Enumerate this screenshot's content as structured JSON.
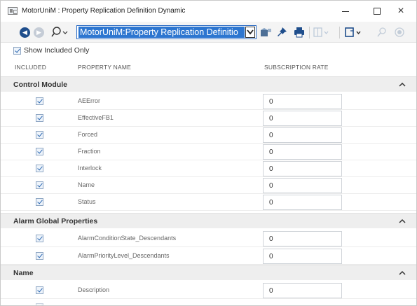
{
  "window": {
    "title": "MotorUniM : Property Replication Definition Dynamic",
    "close_glyph": "×"
  },
  "toolbar": {
    "back_glyph": "◀",
    "forward_glyph": "▶",
    "address_text": "MotorUniM:Property Replication Definitio",
    "icons": [
      "back-icon",
      "forward-icon",
      "search-icon",
      "chevron-down-icon",
      "package-icon",
      "pin-icon",
      "print-icon",
      "columns-icon",
      "document-icon",
      "zoom-icon",
      "target-icon"
    ]
  },
  "filter": {
    "show_included_label": "Show Included Only",
    "checked": true
  },
  "columns": {
    "included": "INCLUDED",
    "property_name": "PROPERTY NAME",
    "subscription_rate": "SUBSCRIPTION RATE"
  },
  "groups": [
    {
      "title": "Control Module",
      "rows": [
        {
          "name": "AEError",
          "rate": "0"
        },
        {
          "name": "EffectiveFB1",
          "rate": "0"
        },
        {
          "name": "Forced",
          "rate": "0"
        },
        {
          "name": "Fraction",
          "rate": "0"
        },
        {
          "name": "Interlock",
          "rate": "0"
        },
        {
          "name": "Name",
          "rate": "0"
        },
        {
          "name": "Status",
          "rate": "0"
        }
      ]
    },
    {
      "title": "Alarm Global Properties",
      "rows": [
        {
          "name": "AlarmConditionState_Descendants",
          "rate": "0"
        },
        {
          "name": "AlarmPriorityLevel_Descendants",
          "rate": "0"
        }
      ]
    },
    {
      "title": "Name",
      "rows": [
        {
          "name": "Description",
          "rate": "0"
        }
      ]
    }
  ],
  "colors": {
    "accent": "#2d76d0",
    "group_bg": "#eeeeee",
    "back_button": "#1f4e8c"
  }
}
